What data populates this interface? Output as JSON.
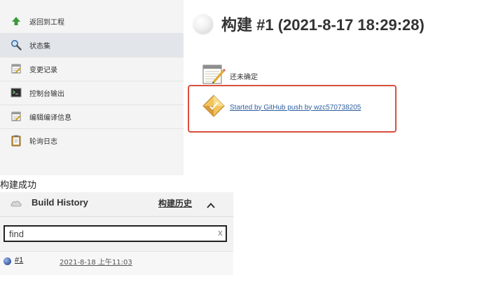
{
  "sidebar": {
    "items": [
      {
        "label": "返回到工程",
        "icon": "arrow-up-icon"
      },
      {
        "label": "状态集",
        "icon": "magnifier-icon"
      },
      {
        "label": "变更记录",
        "icon": "notepad-icon"
      },
      {
        "label": "控制台输出",
        "icon": "terminal-icon"
      },
      {
        "label": "编辑编译信息",
        "icon": "notepad-edit-icon"
      },
      {
        "label": "轮询日志",
        "icon": "clipboard-icon"
      }
    ],
    "active_index": 1
  },
  "build": {
    "title": "构建 #1 (2021-8-17 18:29:28)",
    "status_icon": "grey-ball-icon",
    "note_label": "还未确定",
    "cause_link": "Started by GitHub push by wzc570738205",
    "highlight_color": "#d9503b"
  },
  "caption": "构建成功",
  "build_history": {
    "title": "Build History",
    "trend_link": "构建历史",
    "search_placeholder": "find",
    "clear_glyph": "x",
    "rows": [
      {
        "number": "#1",
        "date": "2021-8-18 上午11:03",
        "status_icon": "blue-ball-icon"
      }
    ]
  }
}
